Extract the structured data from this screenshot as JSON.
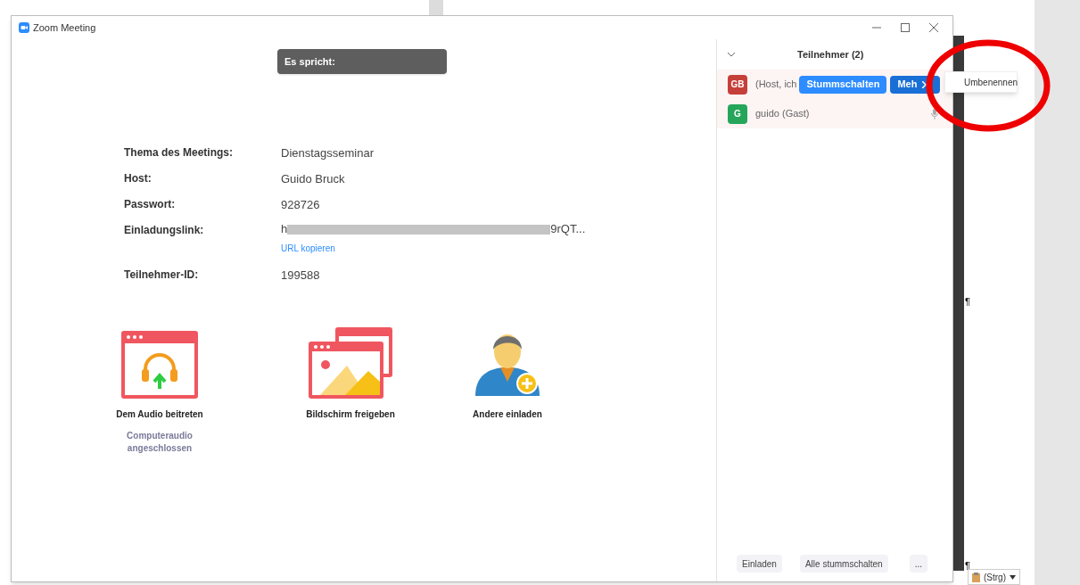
{
  "window": {
    "title": "Zoom Meeting"
  },
  "speaker_banner": "Es spricht:",
  "meeting_info": [
    {
      "label": "Thema des Meetings:",
      "value": "Dienstagsseminar"
    },
    {
      "label": "Host:",
      "value": "Guido Bruck"
    },
    {
      "label": "Passwort:",
      "value": "928726"
    },
    {
      "label": "Einladungslink:",
      "kind": "link",
      "value_start": "h",
      "value_end": "9rQT...",
      "action": "URL kopieren"
    },
    {
      "label": "Teilnehmer-ID:",
      "value": "199588"
    }
  ],
  "actions": [
    {
      "kind": "audio",
      "label": "Dem Audio beitreten",
      "status": "Computeraudio angeschlossen"
    },
    {
      "kind": "share",
      "label": "Bildschirm freigeben"
    },
    {
      "kind": "invite",
      "label": "Andere einladen"
    }
  ],
  "participants_panel": {
    "title": "Teilnehmer (2)",
    "participants": [
      {
        "initials": "GB",
        "color": "#c6403a",
        "name": "(Host, ich",
        "buttons": [
          "Stummschalten",
          "Meh"
        ],
        "menu": [
          "Umbenennen"
        ]
      },
      {
        "initials": "G",
        "color": "#26a65b",
        "name": "guido (Gast)",
        "mic": true
      }
    ],
    "footer_buttons": [
      "Einladen",
      "Alle stummschalten",
      "..."
    ]
  },
  "paste_options": "(Strg)",
  "pilcrows": [
    "¶",
    "¶"
  ]
}
